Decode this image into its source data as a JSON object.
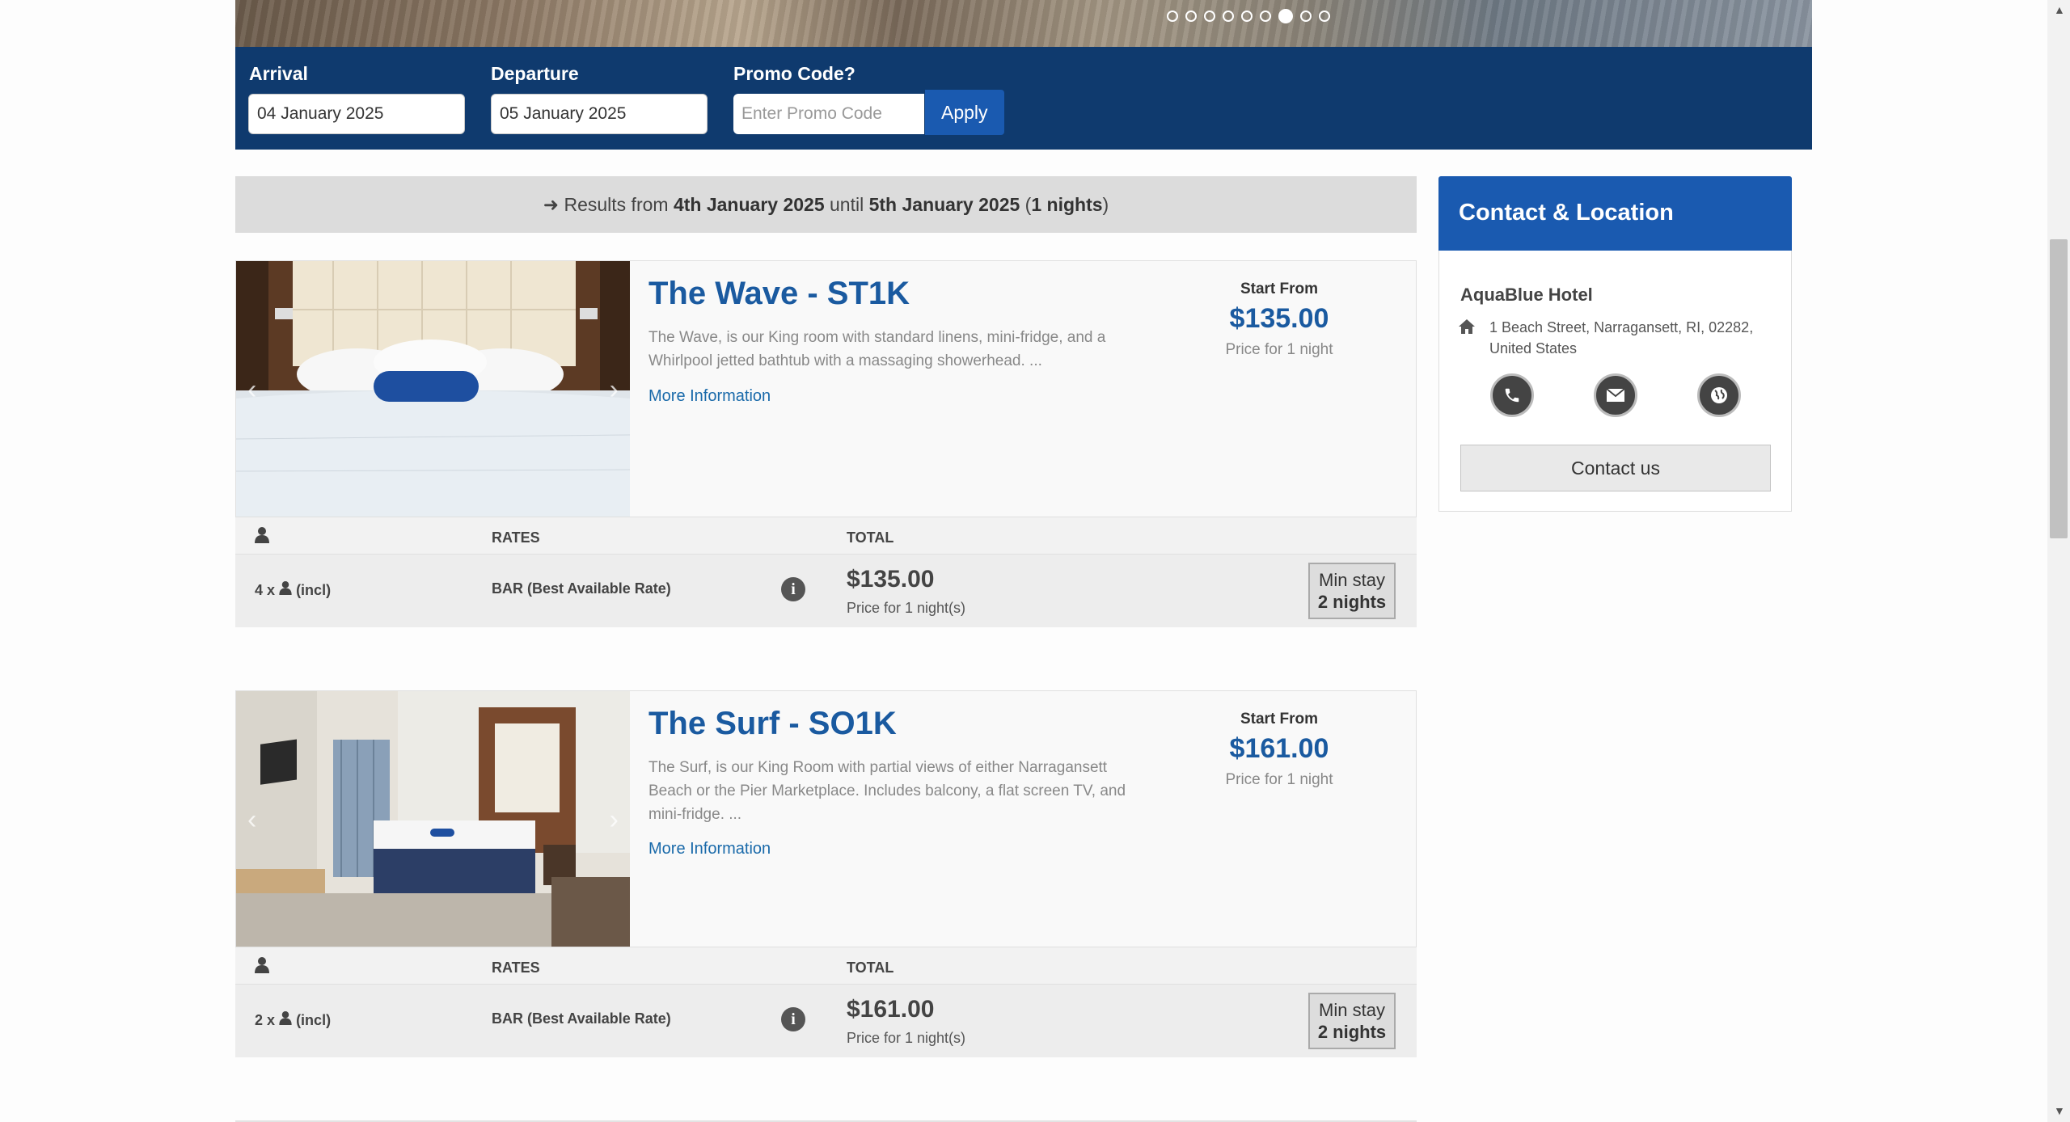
{
  "search": {
    "arrival_label": "Arrival",
    "arrival_value": "04 January 2025",
    "departure_label": "Departure",
    "departure_value": "05 January 2025",
    "promo_label": "Promo Code?",
    "promo_placeholder": "Enter Promo Code",
    "apply_label": "Apply"
  },
  "results": {
    "prefix": "Results from",
    "from_date": "4th January 2025",
    "until_word": "until",
    "to_date": "5th January 2025",
    "nights_open": "(",
    "nights": "1 nights",
    "nights_close": ")"
  },
  "rooms": [
    {
      "title": "The Wave - ST1K",
      "description": "The Wave, is our King room with standard linens, mini-fridge, and a Whirlpool jetted bathtub with a massaging showerhead. ...",
      "more_info": "More Information",
      "start_from": "Start From",
      "price": "$135.00",
      "price_note": "Price for 1 night",
      "rates_header": {
        "rates": "RATES",
        "total": "TOTAL"
      },
      "rate": {
        "occupancy_count": "4 x",
        "occupancy_incl": "(incl)",
        "rate_name": "BAR (Best Available Rate)",
        "total": "$135.00",
        "total_note": "Price for 1 night(s)",
        "min_stay_label": "Min stay",
        "min_stay_value": "2 nights"
      }
    },
    {
      "title": "The Surf - SO1K",
      "description": "The Surf, is our King Room with partial views of either Narragansett Beach or the Pier Marketplace. Includes balcony, a flat screen TV, and mini-fridge. ...",
      "more_info": "More Information",
      "start_from": "Start From",
      "price": "$161.00",
      "price_note": "Price for 1 night",
      "rates_header": {
        "rates": "RATES",
        "total": "TOTAL"
      },
      "rate": {
        "occupancy_count": "2 x",
        "occupancy_incl": "(incl)",
        "rate_name": "BAR (Best Available Rate)",
        "total": "$161.00",
        "total_note": "Price for 1 night(s)",
        "min_stay_label": "Min stay",
        "min_stay_value": "2 nights"
      }
    }
  ],
  "contact": {
    "title": "Contact & Location",
    "hotel_name": "AquaBlue Hotel",
    "address": "1 Beach Street, Narragansett, RI, 02282, United States",
    "button": "Contact us",
    "icons": [
      "phone-icon",
      "envelope-icon",
      "globe-icon"
    ]
  },
  "carousel": {
    "total_slides": 9,
    "active_slide": 7
  },
  "colors": {
    "header_blue": "#0f3a6e",
    "accent_blue": "#1a5ab0",
    "title_blue": "#1a5aa0"
  }
}
